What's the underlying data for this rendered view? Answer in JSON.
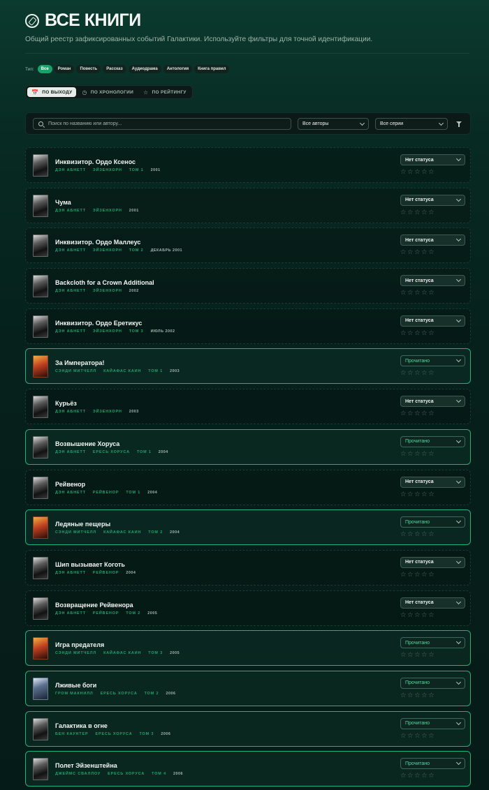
{
  "header": {
    "title": "ВСЕ КНИГИ",
    "subtitle": "Общий реестр зафиксированных событий Галактики. Используйте фильтры для точной идентификации.",
    "icon": "compass-icon"
  },
  "type_filter": {
    "label": "Тип:",
    "chips": [
      "Все",
      "Роман",
      "Повесть",
      "Рассказ",
      "Аудиодрама",
      "Антология",
      "Книга правил"
    ],
    "active": "Все"
  },
  "sort": {
    "options": [
      {
        "label": "ПО ВЫХОДУ",
        "icon": "calendar-icon",
        "active": true
      },
      {
        "label": "ПО ХРОНОЛОГИИ",
        "icon": "clock-icon",
        "active": false
      },
      {
        "label": "ПО РЕЙТИНГУ",
        "icon": "star-icon",
        "active": false
      }
    ]
  },
  "filters": {
    "search_placeholder": "Поиск по названию или автору...",
    "authors": "Все авторы",
    "series": "Все серии"
  },
  "books": [
    {
      "title": "Инквизитор. Ордо Ксенос",
      "author": "Дэн Абнетт",
      "series": "Эйзенхорн",
      "volume": "Том 1",
      "year": "2001",
      "status": "Нет статуса",
      "rating": 0
    },
    {
      "title": "Чума",
      "author": "Дэн Абнетт",
      "series": "Эйзенхорн",
      "volume": "",
      "year": "2001",
      "status": "Нет статуса",
      "rating": 0
    },
    {
      "title": "Инквизитор. Ордо Маллеус",
      "author": "Дэн Абнетт",
      "series": "Эйзенхорн",
      "volume": "Том 2",
      "year": "декабрь 2001",
      "status": "Нет статуса",
      "rating": 0
    },
    {
      "title": "Backcloth for a Crown Additional",
      "author": "Дэн Абнетт",
      "series": "Эйзенхорн",
      "volume": "",
      "year": "2002",
      "status": "Нет статуса",
      "rating": 0
    },
    {
      "title": "Инквизитор. Ордо Еретикус",
      "author": "Дэн Абнетт",
      "series": "Эйзенхорн",
      "volume": "Том 3",
      "year": "июль 2002",
      "status": "Нет статуса",
      "rating": 0
    },
    {
      "title": "За Императора!",
      "author": "Сэнди Митчелл",
      "series": "Кайафас Каин",
      "volume": "Том 1",
      "year": "2003",
      "status": "Прочитано",
      "rating": 0
    },
    {
      "title": "Курьёз",
      "author": "Дэн Абнетт",
      "series": "Эйзенхорн",
      "volume": "",
      "year": "2003",
      "status": "Нет статуса",
      "rating": 0
    },
    {
      "title": "Возвышение Хоруса",
      "author": "Дэн Абнетт",
      "series": "Ересь Хоруса",
      "volume": "Том 1",
      "year": "2004",
      "status": "Прочитано",
      "rating": 0
    },
    {
      "title": "Рейвенор",
      "author": "Дэн Абнетт",
      "series": "Рейвенор",
      "volume": "Том 1",
      "year": "2004",
      "status": "Нет статуса",
      "rating": 0
    },
    {
      "title": "Ледяные пещеры",
      "author": "Сэнди Митчелл",
      "series": "Кайафас Каин",
      "volume": "Том 2",
      "year": "2004",
      "status": "Прочитано",
      "rating": 0
    },
    {
      "title": "Шип вызывает Коготь",
      "author": "Дэн Абнетт",
      "series": "Рейвенор",
      "volume": "",
      "year": "2004",
      "status": "Нет статуса",
      "rating": 0
    },
    {
      "title": "Возвращение Рейвенора",
      "author": "Дэн Абнетт",
      "series": "Рейвенор",
      "volume": "Том 2",
      "year": "2005",
      "status": "Нет статуса",
      "rating": 0
    },
    {
      "title": "Игра предателя",
      "author": "Сэнди Митчелл",
      "series": "Кайафас Каин",
      "volume": "Том 3",
      "year": "2005",
      "status": "Прочитано",
      "rating": 0
    },
    {
      "title": "Лживые боги",
      "author": "Гром Макнилл",
      "series": "Ересь Хоруса",
      "volume": "Том 2",
      "year": "2006",
      "status": "Прочитано",
      "rating": 0
    },
    {
      "title": "Галактика в огне",
      "author": "Бен Каунтер",
      "series": "Ересь Хоруса",
      "volume": "Том 3",
      "year": "2006",
      "status": "Прочитано",
      "rating": 0
    },
    {
      "title": "Полет Эйзенштейна",
      "author": "Джеймс Сваллоу",
      "series": "Ересь Хоруса",
      "volume": "Том 4",
      "year": "2006",
      "status": "Прочитано",
      "rating": 0
    }
  ],
  "colors": {
    "accent": "#1fb27a",
    "background": "#062019"
  }
}
